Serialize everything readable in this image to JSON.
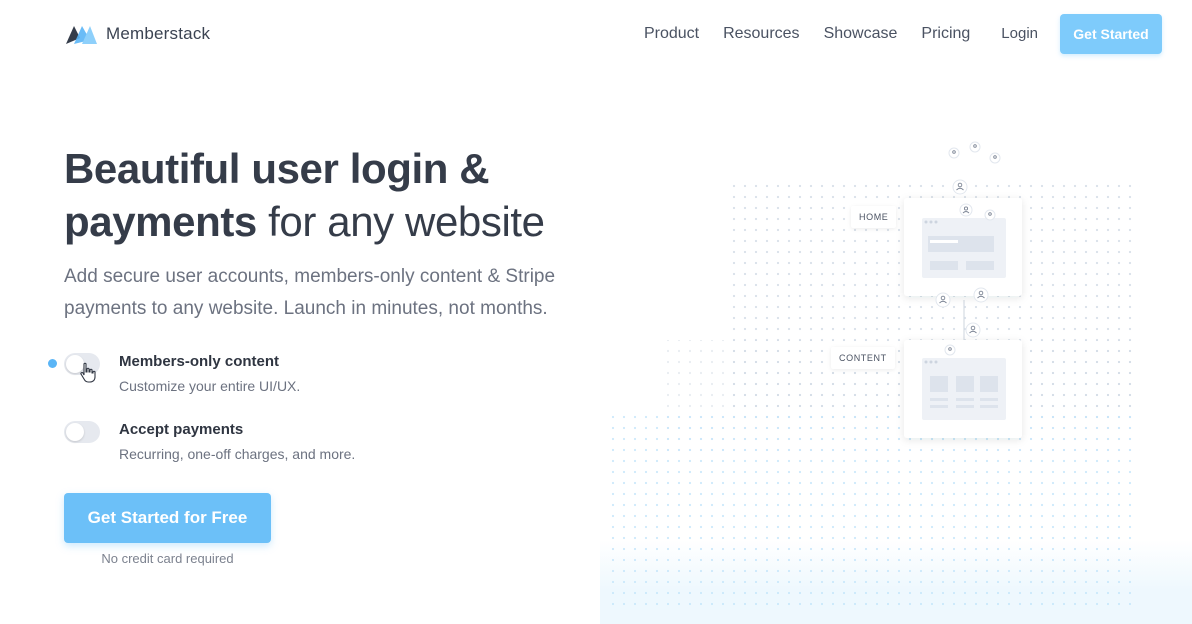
{
  "brand": {
    "name": "Memberstack",
    "logo_colors": [
      "#343c4a",
      "#5ab5f6"
    ]
  },
  "nav": {
    "items": [
      "Product",
      "Resources",
      "Showcase",
      "Pricing"
    ],
    "login": "Login",
    "cta": "Get Started"
  },
  "hero": {
    "headline_line1": "Beautiful user login &",
    "headline_bold2": "payments",
    "headline_rest2": " for any website",
    "subhead": "Add secure user accounts, members-only content & Stripe payments to any website. Launch in minutes, not months."
  },
  "features": [
    {
      "title": "Members-only content",
      "desc": "Customize your entire UI/UX.",
      "enabled": false
    },
    {
      "title": "Accept payments",
      "desc": "Recurring, one-off charges, and more.",
      "enabled": false
    }
  ],
  "cta": {
    "label": "Get Started for Free",
    "note": "No credit card required"
  },
  "illustration": {
    "labels": [
      "HOME",
      "CONTENT"
    ],
    "icons": [
      "user-icon",
      "browser-window-icon"
    ]
  },
  "colors": {
    "accent": "#6cc0f8",
    "accent_light": "#7ecbfb",
    "heading": "#353c49",
    "muted": "#6c7280"
  }
}
